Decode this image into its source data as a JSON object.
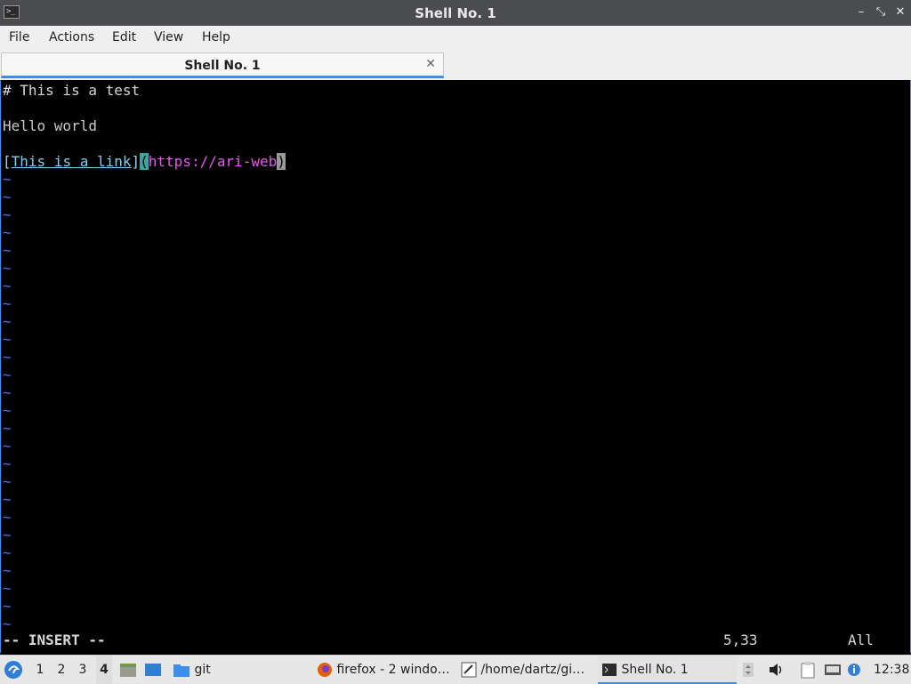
{
  "window": {
    "title": "Shell No. 1",
    "controls": {
      "minimize": "–",
      "maximize": "⤡",
      "close": "✕"
    }
  },
  "menubar": {
    "items": [
      "File",
      "Actions",
      "Edit",
      "View",
      "Help"
    ]
  },
  "tabs": [
    {
      "label": "Shell No. 1",
      "close": "✕"
    }
  ],
  "editor": {
    "line1": "# This is a test",
    "line2": "Hello world",
    "line3": {
      "open_bracket": "[",
      "link_text": "This is a link",
      "close_bracket": "]",
      "open_paren": "(",
      "url": "https://ari-web",
      "close_paren": ")"
    },
    "empty_line_marker": "~",
    "mode": "-- INSERT --",
    "cursor_position": "5,33",
    "scroll": "All"
  },
  "taskbar": {
    "desktops": [
      "1",
      "2",
      "3",
      "4"
    ],
    "active_desktop": "4",
    "quicklaunch_folder": "git",
    "tasks": [
      {
        "label": "firefox - 2 windo…",
        "icon": "firefox-icon"
      },
      {
        "label": "/home/dartz/gi…",
        "icon": "text-editor-icon"
      },
      {
        "label": "Shell No. 1",
        "icon": "terminal-icon"
      }
    ],
    "clock": "12:38"
  },
  "colors": {
    "accent": "#3d8ee8",
    "titlebar": "#4a4c50",
    "link": "#7fd0e8",
    "url": "#e25ce8",
    "tilde": "#4f6fdc"
  }
}
